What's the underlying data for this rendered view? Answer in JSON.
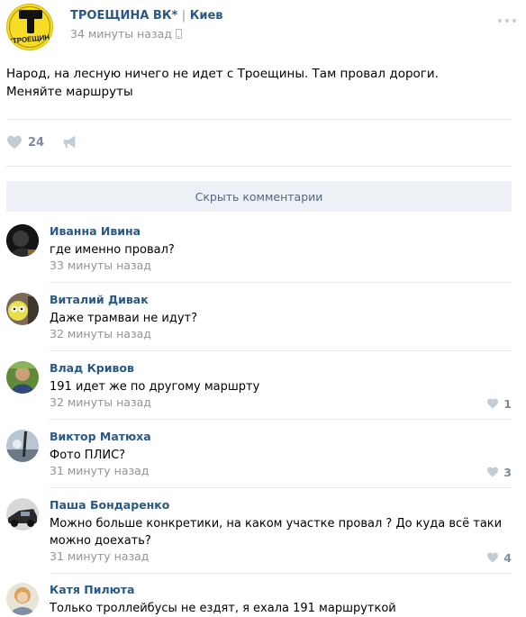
{
  "post": {
    "group_name": "ТРОЕЩИНА ВК*",
    "separator": "|",
    "city": "Киев",
    "time": "34 минуты назад",
    "text": "Народ, на лесную ничего не идет с Троещины. Там провал дороги. Меняйте маршруты",
    "likes": "24",
    "avatar_text": "\"ТРОЕЩИНА\"",
    "icons": {
      "more": "more-icon",
      "device": "phone-icon",
      "like": "heart-icon",
      "share": "megaphone-icon"
    }
  },
  "comments_toggle": "Скрыть комментарии",
  "comments": [
    {
      "author": "Иванна Ивина",
      "text": "где именно провал?",
      "time": "33 минуты назад",
      "likes": ""
    },
    {
      "author": "Виталий Дивак",
      "text": "Даже трамваи не идут?",
      "time": "32 минуты назад",
      "likes": ""
    },
    {
      "author": "Влад Кривов",
      "text": "191 идет же по другому маршрту",
      "time": "32 минуты назад",
      "likes": "1"
    },
    {
      "author": "Виктор Матюха",
      "text": "Фото ПЛИС?",
      "time": "31 минуту назад",
      "likes": "3"
    },
    {
      "author": "Паша Бондаренко",
      "text": "Можно больше конкретики, на каком участке провал ? До куда всё таки можно доехать?",
      "time": "31 минуту назад",
      "likes": "4"
    },
    {
      "author": "Катя Пилюта",
      "text": "Только троллейбусы не ездят, я ехала 191 маршруткой",
      "time": "",
      "likes": ""
    }
  ],
  "colors": {
    "link": "#2a5885",
    "meta": "#939393",
    "icon": "#c5ccd4",
    "toggle_bg": "#edf0f4"
  }
}
